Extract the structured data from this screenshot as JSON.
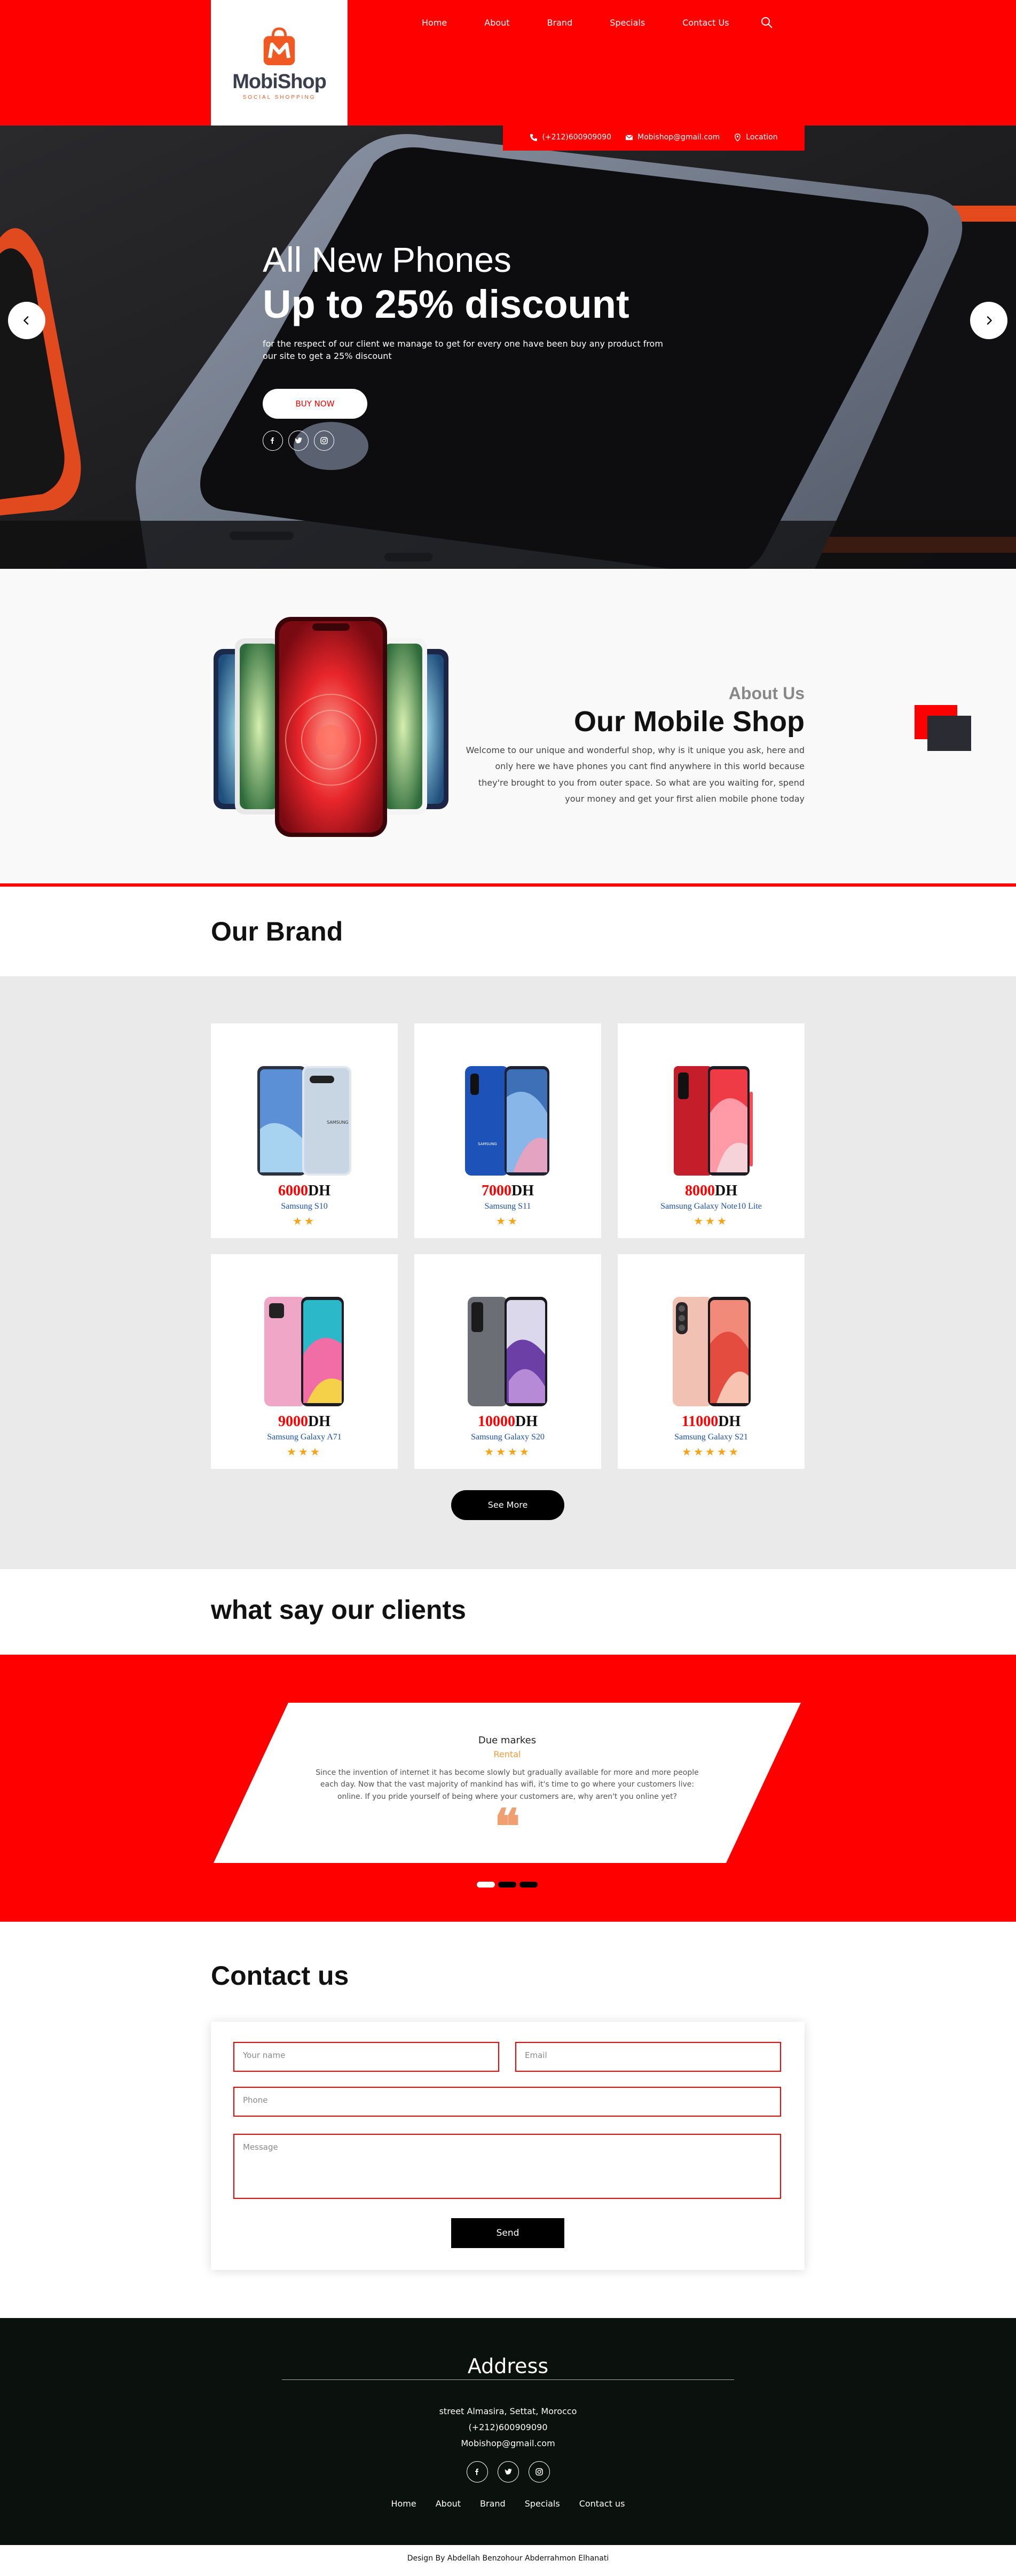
{
  "brand": {
    "name": "MobiShop",
    "tagline": "SOCIAL SHOPPING"
  },
  "nav": [
    {
      "label": "Home"
    },
    {
      "label": "About"
    },
    {
      "label": "Brand"
    },
    {
      "label": "Specials"
    },
    {
      "label": "Contact Us"
    }
  ],
  "contact_bar": {
    "phone": "(+212)600909090",
    "email": "Mobishop@gmail.com",
    "location": "Location"
  },
  "hero": {
    "title": "All New Phones",
    "subtitle": "Up to 25% discount",
    "text": "for the respect of our client we manage to get for every one have been buy any product from our site to get a 25% discount",
    "button": "BUY NOW"
  },
  "about": {
    "label": "About Us",
    "title": "Our Mobile Shop",
    "text": "Welcome to our unique and wonderful shop, why is it unique you ask, here and only here we have phones you cant find anywhere in this world because they're brought to you from outer space. So what are you waiting for, spend your money and get your first alien mobile phone today"
  },
  "brand_section": {
    "title": "Our Brand",
    "see_more": "See More",
    "currency": "DH",
    "products": [
      {
        "price": "6000",
        "name": "Samsung S10",
        "rating": 2,
        "stars": "★★"
      },
      {
        "price": "7000",
        "name": "Samsung S11",
        "rating": 2,
        "stars": "★★"
      },
      {
        "price": "8000",
        "name": "Samsung Galaxy Note10 Lite",
        "rating": 3,
        "stars": "★★★"
      },
      {
        "price": "9000",
        "name": "Samsung Galaxy A71",
        "rating": 3,
        "stars": "★★★"
      },
      {
        "price": "10000",
        "name": "Samsung Galaxy S20",
        "rating": 4,
        "stars": "★★★★"
      },
      {
        "price": "11000",
        "name": "Samsung Galaxy S21",
        "rating": 5,
        "stars": "★★★★★"
      }
    ]
  },
  "clients": {
    "title": "what say our clients",
    "name": "Due markes",
    "role": "Rental",
    "text": "Since the invention of internet it has become slowly but gradually available for more and more people each day. Now that the vast majority of mankind has wifi, it's time to go where your customers live: online. If you pride yourself of being where your customers are, why aren't you online yet?",
    "quote_mark": "❝"
  },
  "contact": {
    "title": "Contact us",
    "name_placeholder": "Your name",
    "email_placeholder": "Email",
    "phone_placeholder": "Phone",
    "message_placeholder": "Message",
    "send": "Send"
  },
  "footer": {
    "title": "Address",
    "street": "street Almasira, Settat, Morocco",
    "phone": "(+212)600909090",
    "email": "Mobishop@gmail.com",
    "nav": [
      "Home",
      "About",
      "Brand",
      "Specials",
      "Contact us"
    ],
    "credit": "Design By Abdellah Benzohour Abderrahmon Elhanati"
  },
  "colors": {
    "accent": "#ff0000",
    "dark": "#0b110c",
    "gray_bg": "#eaeaea",
    "star": "#f6a315",
    "link_blue": "#1a4fb0"
  }
}
